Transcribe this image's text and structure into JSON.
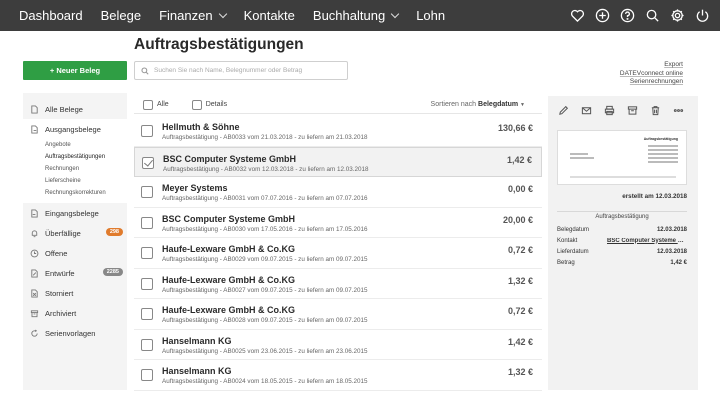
{
  "nav": {
    "items": [
      {
        "label": "Dashboard",
        "dropdown": false
      },
      {
        "label": "Belege",
        "dropdown": false
      },
      {
        "label": "Finanzen",
        "dropdown": true
      },
      {
        "label": "Kontakte",
        "dropdown": false
      },
      {
        "label": "Buchhaltung",
        "dropdown": true
      },
      {
        "label": "Lohn",
        "dropdown": false
      }
    ],
    "icons": [
      "heart-icon",
      "plus-circle-icon",
      "help-icon",
      "search-icon",
      "gear-icon",
      "power-icon"
    ]
  },
  "page_title": "Auftragsbestätigungen",
  "new_button": "+ Neuer Beleg",
  "search": {
    "placeholder": "Suchen Sie nach Name, Belegnummer oder Betrag"
  },
  "right_links": [
    "Export",
    "DATEVconnect online",
    "Serienrechnungen"
  ],
  "sidebar": {
    "alle_belege": "Alle Belege",
    "ausgangsbelege": "Ausgangsbelege",
    "sub_items": [
      "Angebote",
      "Auftragsbestätigungen",
      "Rechnungen",
      "Lieferscheine",
      "Rechnungskorrekturen"
    ],
    "eingangsbelege": "Eingangsbelege",
    "ueberfaellige": "Überfällige",
    "ueberfaellige_count": "298",
    "offene": "Offene",
    "entwuerfe": "Entwürfe",
    "entwuerfe_count": "2285",
    "storniert": "Storniert",
    "archiviert": "Archiviert",
    "serienvorlagen": "Serienvorlagen"
  },
  "list_header": {
    "all_label": "Alle",
    "details_label": "Details",
    "sort_prefix": "Sortieren nach",
    "sort_field": "Belegdatum"
  },
  "rows": [
    {
      "name": "Hellmuth & Söhne",
      "sub": "Auftragsbestätigung - AB0033 vom 21.03.2018 - zu liefern am 21.03.2018",
      "amount": "130,66 €",
      "selected": false
    },
    {
      "name": "BSC Computer Systeme GmbH",
      "sub": "Auftragsbestätigung - AB0032 vom 12.03.2018 - zu liefern am 12.03.2018",
      "amount": "1,42 €",
      "selected": true
    },
    {
      "name": "Meyer Systems",
      "sub": "Auftragsbestätigung - AB0031 vom 07.07.2016 - zu liefern am 07.07.2016",
      "amount": "0,00 €",
      "selected": false
    },
    {
      "name": "BSC Computer Systeme GmbH",
      "sub": "Auftragsbestätigung - AB0030 vom 17.05.2016 - zu liefern am 17.05.2016",
      "amount": "20,00 €",
      "selected": false
    },
    {
      "name": "Haufe-Lexware GmbH & Co.KG",
      "sub": "Auftragsbestätigung - AB0029 vom 09.07.2015 - zu liefern am 09.07.2015",
      "amount": "0,72 €",
      "selected": false
    },
    {
      "name": "Haufe-Lexware GmbH & Co.KG",
      "sub": "Auftragsbestätigung - AB0027 vom 09.07.2015 - zu liefern am 09.07.2015",
      "amount": "1,32 €",
      "selected": false
    },
    {
      "name": "Haufe-Lexware GmbH & Co.KG",
      "sub": "Auftragsbestätigung - AB0028 vom 09.07.2015 - zu liefern am 09.07.2015",
      "amount": "0,72 €",
      "selected": false
    },
    {
      "name": "Hanselmann KG",
      "sub": "Auftragsbestätigung - AB0025 vom 23.06.2015 - zu liefern am 23.06.2015",
      "amount": "1,42 €",
      "selected": false
    },
    {
      "name": "Hanselmann KG",
      "sub": "Auftragsbestätigung - AB0024 vom 18.05.2015 - zu liefern am 18.05.2015",
      "amount": "1,32 €",
      "selected": false
    }
  ],
  "detail": {
    "toolbar_icons": [
      "pencil-icon",
      "mail-icon",
      "print-icon",
      "archive-icon",
      "trash-icon",
      "more-icon"
    ],
    "created": "erstellt am 12.03.2018",
    "doc_type": "Auftragsbestätigung",
    "meta": [
      {
        "label": "Belegdatum",
        "value": "12.03.2018",
        "link": false
      },
      {
        "label": "Kontakt",
        "value": "BSC Computer Systeme G...",
        "link": true
      },
      {
        "label": "Lieferdatum",
        "value": "12.03.2018",
        "link": false
      },
      {
        "label": "Betrag",
        "value": "1,42 €",
        "link": false
      }
    ]
  },
  "colors": {
    "topnav": "#3d3d3d",
    "accent": "#2f9e44",
    "badge_orange": "#e07b2c"
  }
}
